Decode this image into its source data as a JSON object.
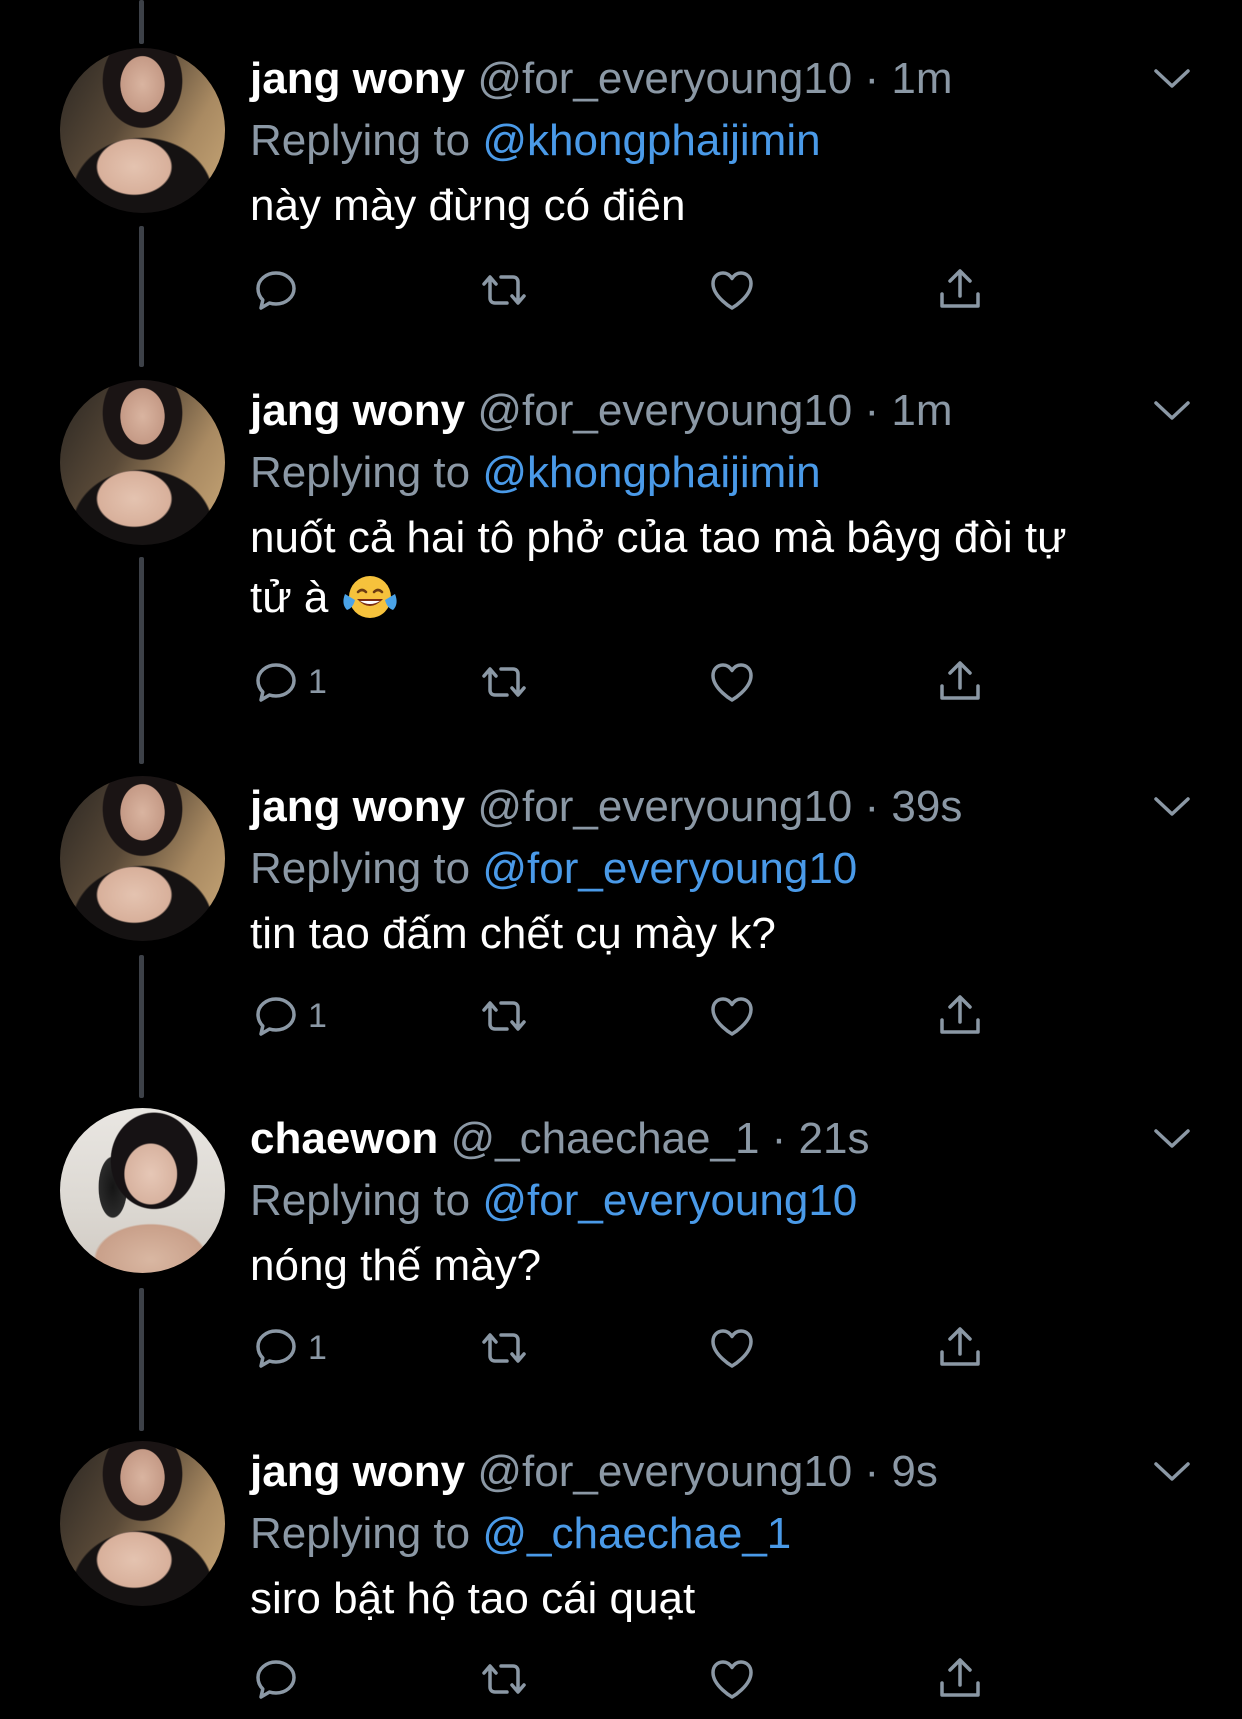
{
  "tweets": [
    {
      "display_name": "jang wony",
      "handle": "@for_everyoung10",
      "dot": "·",
      "time": "1m",
      "replying_label": "Replying to",
      "replying_to": "@khongphaijimin",
      "text": "này mày đừng có điên",
      "reply_count": ""
    },
    {
      "display_name": "jang wony",
      "handle": "@for_everyoung10",
      "dot": "·",
      "time": "1m",
      "replying_label": "Replying to",
      "replying_to": "@khongphaijimin",
      "text_line1": "nuốt cả hai tô phở của tao mà bâyg đòi tự",
      "text_line2": "tử à",
      "emoji": "face-with-tears-of-joy",
      "reply_count": "1"
    },
    {
      "display_name": "jang wony",
      "handle": "@for_everyoung10",
      "dot": "·",
      "time": "39s",
      "replying_label": "Replying to",
      "replying_to": "@for_everyoung10",
      "text": "tin tao đấm chết cụ mày k?",
      "reply_count": "1"
    },
    {
      "display_name": "chaewon",
      "handle": "@_chaechae_1",
      "dot": "·",
      "time": "21s",
      "replying_label": "Replying to",
      "replying_to": "@for_everyoung10",
      "text": "nóng thế mày?",
      "reply_count": "1"
    },
    {
      "display_name": "jang wony",
      "handle": "@for_everyoung10",
      "dot": "·",
      "time": "9s",
      "replying_label": "Replying to",
      "replying_to": "@_chaechae_1",
      "text": "siro bật hộ tao cái quạt",
      "reply_count": ""
    }
  ],
  "colors": {
    "background": "#000000",
    "secondary_text": "#8b98a5",
    "link": "#4a9ae8",
    "thread_line": "#3d4148"
  },
  "icons": [
    "reply-icon",
    "retweet-icon",
    "like-icon",
    "share-icon",
    "chevron-down-icon"
  ]
}
